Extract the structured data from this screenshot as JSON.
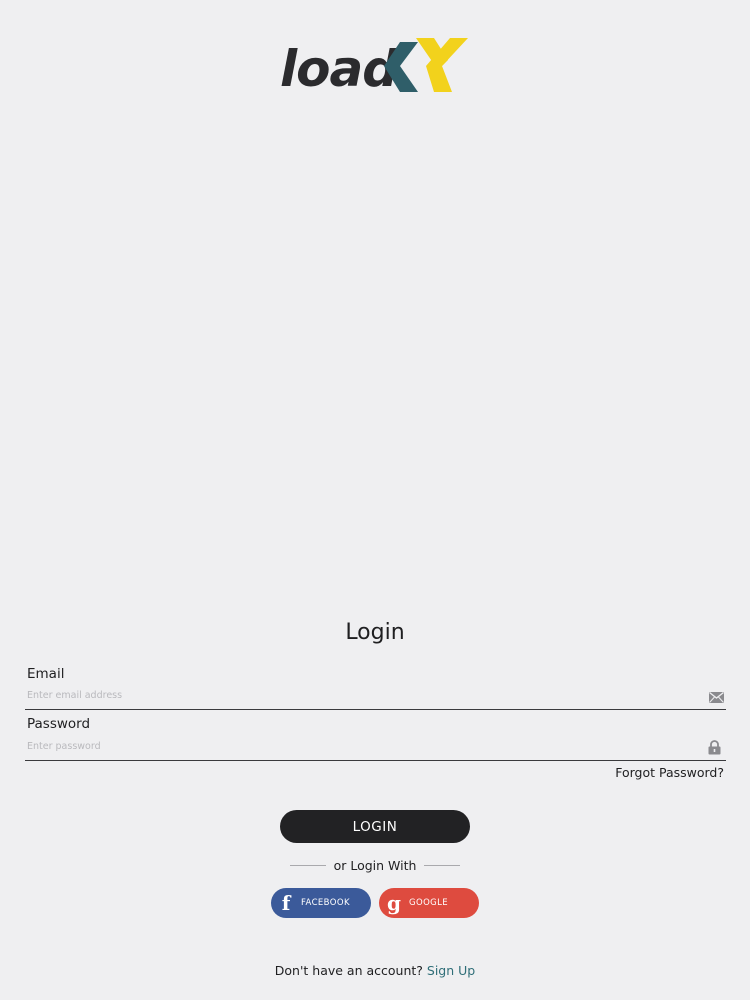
{
  "brand": {
    "logo_text": "load",
    "logo_mark": "X",
    "colors": {
      "text": "#2b2b2e",
      "chevron_dark": "#2f5e69",
      "chevron_yellow": "#f2d21c"
    }
  },
  "login": {
    "title": "Login",
    "email": {
      "label": "Email",
      "placeholder": "Enter email address",
      "value": "",
      "icon": "envelope-icon"
    },
    "password": {
      "label": "Password",
      "placeholder": "Enter password",
      "value": "",
      "icon": "lock-icon"
    },
    "forgot_label": "Forgot Password?",
    "login_button": "LOGIN",
    "or_text": "or Login With",
    "social": {
      "facebook": {
        "label": "FACEBOOK",
        "glyph": "f",
        "color": "#3b5a9a"
      },
      "google": {
        "label": "GOOGLE",
        "glyph": "g",
        "color": "#de4b3f"
      }
    },
    "signup_prompt": "Don't have an account?",
    "signup_link": "Sign Up"
  }
}
